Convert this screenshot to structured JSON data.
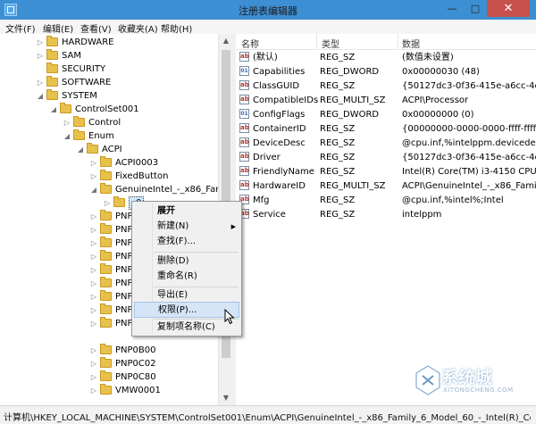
{
  "window": {
    "title": "注册表编辑器",
    "min_glyph": "—",
    "max_glyph": "□",
    "close_glyph": "✕"
  },
  "menu": [
    "文件(F)",
    "编辑(E)",
    "查看(V)",
    "收藏夹(A)",
    "帮助(H)"
  ],
  "tree": [
    {
      "label": "HARDWARE",
      "arrow": "▷"
    },
    {
      "label": "SAM",
      "arrow": "▷"
    },
    {
      "label": "SECURITY",
      "arrow": ""
    },
    {
      "label": "SOFTWARE",
      "arrow": "▷"
    },
    {
      "label": "SYSTEM",
      "arrow": "◢"
    },
    {
      "label": "ControlSet001",
      "arrow": "◢"
    },
    {
      "label": "Control",
      "arrow": "▷"
    },
    {
      "label": "Enum",
      "arrow": "◢"
    },
    {
      "label": "ACPI",
      "arrow": "◢"
    },
    {
      "label": "ACPI0003",
      "arrow": "▷"
    },
    {
      "label": "FixedButton",
      "arrow": "▷"
    },
    {
      "label": "GenuineIntel_-_x86_Family_6_",
      "arrow": "◢"
    },
    {
      "label": "_0",
      "arrow": "▷"
    },
    {
      "label": "PNP0C",
      "arrow": "▷"
    },
    {
      "label": "PNP0",
      "arrow": "▷"
    },
    {
      "label": "PNP0",
      "arrow": "▷"
    },
    {
      "label": "PNP0",
      "arrow": "▷"
    },
    {
      "label": "PNP0",
      "arrow": "▷"
    },
    {
      "label": "PNP0",
      "arrow": "▷"
    },
    {
      "label": "PNP0",
      "arrow": "▷"
    },
    {
      "label": "PNP0",
      "arrow": "▷"
    },
    {
      "label": "PNP0A",
      "arrow": "▷"
    },
    {
      "label": "PNP0B00",
      "arrow": "▷"
    },
    {
      "label": "PNP0C02",
      "arrow": "▷"
    },
    {
      "label": "PNP0C80",
      "arrow": "▷"
    },
    {
      "label": "VMW0001",
      "arrow": "▷"
    }
  ],
  "list": {
    "headers": {
      "name": "名称",
      "type": "类型",
      "data": "数据"
    },
    "rows": [
      {
        "name": "(默认)",
        "type": "REG_SZ",
        "data": "(数值未设置)",
        "icon": "ab"
      },
      {
        "name": "Capabilities",
        "type": "REG_DWORD",
        "data": "0x00000030 (48)",
        "icon": "bin"
      },
      {
        "name": "ClassGUID",
        "type": "REG_SZ",
        "data": "{50127dc3-0f36-415e-a6cc-4cb3b",
        "icon": "ab"
      },
      {
        "name": "CompatibleIDs",
        "type": "REG_MULTI_SZ",
        "data": "ACPI\\Processor",
        "icon": "ab"
      },
      {
        "name": "ConfigFlags",
        "type": "REG_DWORD",
        "data": "0x00000000 (0)",
        "icon": "bin"
      },
      {
        "name": "ContainerID",
        "type": "REG_SZ",
        "data": "{00000000-0000-0000-ffff-ffffffff",
        "icon": "ab"
      },
      {
        "name": "DeviceDesc",
        "type": "REG_SZ",
        "data": "@cpu.inf,%intelppm.devicedesc%",
        "icon": "ab"
      },
      {
        "name": "Driver",
        "type": "REG_SZ",
        "data": "{50127dc3-0f36-415e-a6cc-4cb3b",
        "icon": "ab"
      },
      {
        "name": "FriendlyName",
        "type": "REG_SZ",
        "data": "Intel(R) Core(TM) i3-4150 CPU @",
        "icon": "ab"
      },
      {
        "name": "HardwareID",
        "type": "REG_MULTI_SZ",
        "data": "ACPI\\GenuineIntel_-_x86_Family_6_",
        "icon": "ab"
      },
      {
        "name": "Mfg",
        "type": "REG_SZ",
        "data": "@cpu.inf,%intel%;Intel",
        "icon": "ab"
      },
      {
        "name": "Service",
        "type": "REG_SZ",
        "data": "intelppm",
        "icon": "ab"
      }
    ]
  },
  "context_menu": {
    "expand": "展开",
    "new": "新建(N)",
    "new_arrow": "▶",
    "find": "查找(F)...",
    "delete": "删除(D)",
    "rename": "重命名(R)",
    "export": "导出(E)",
    "permissions": "权限(P)...",
    "copy_name": "复制项名称(C)"
  },
  "status": "计算机\\HKEY_LOCAL_MACHINE\\SYSTEM\\ControlSet001\\Enum\\ACPI\\GenuineIntel_-_x86_Family_6_Model_60_-_Intel(R)_Core(TM)_i3-415",
  "watermark": {
    "text": "系统城",
    "sub": "XITONGCHENG.COM"
  },
  "scroll": {
    "up": "▲",
    "down": "▼"
  }
}
